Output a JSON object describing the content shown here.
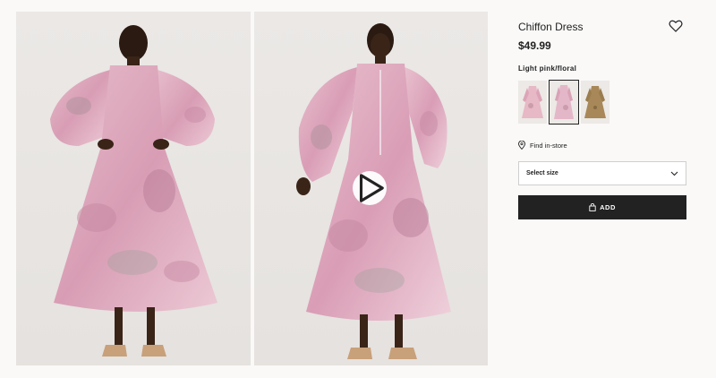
{
  "product": {
    "title": "Chiffon Dress",
    "price": "$49.99",
    "color_name": "Light pink/floral"
  },
  "gallery": {
    "images": [
      {
        "name": "product-photo-back",
        "icon": "model-back-view"
      },
      {
        "name": "product-photo-front",
        "icon": "model-front-view"
      }
    ],
    "video_icon": "play-icon"
  },
  "swatches": [
    {
      "name": "swatch-pink-floral-alt",
      "color": "#e7b8c6",
      "selected": false
    },
    {
      "name": "swatch-light-pink-floral",
      "color": "#e3b7c8",
      "selected": true
    },
    {
      "name": "swatch-beige-pattern",
      "color": "#a88858",
      "selected": false
    }
  ],
  "store": {
    "label": "Find in-store",
    "icon": "location-pin-icon"
  },
  "size": {
    "placeholder": "Select size",
    "icon": "chevron-down-icon"
  },
  "cart": {
    "label": "ADD",
    "icon": "bag-icon"
  },
  "favorite": {
    "icon": "heart-icon"
  },
  "colors": {
    "accent": "#222222",
    "dress_pink": "#e2b2c4",
    "skin": "#3a2418"
  }
}
